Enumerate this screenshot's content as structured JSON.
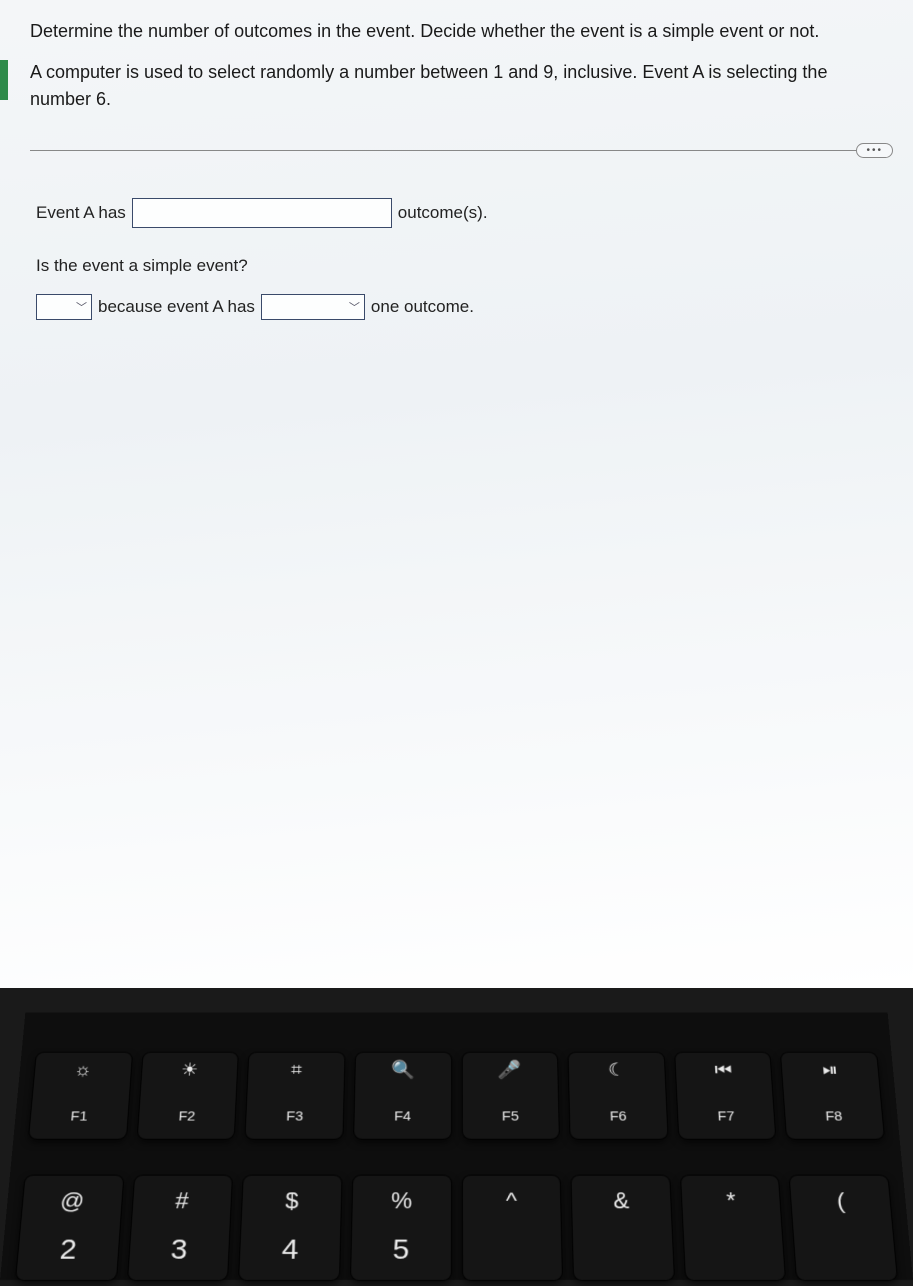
{
  "question": {
    "line1": "Determine the number of outcomes in the event. Decide whether the event is a simple event or not.",
    "line2": "A computer is used to select randomly a number between 1 and 9, inclusive. Event A is selecting the number 6."
  },
  "more_button": "•••",
  "answer": {
    "prefix": "Event A has",
    "outcomes_input": "",
    "suffix": "outcome(s).",
    "sub_question": "Is the event a simple event?",
    "yesno_value": "",
    "mid": "because event A has",
    "relation_value": "",
    "tail": "one outcome."
  },
  "keyboard": {
    "frow": [
      {
        "icon": "☼",
        "label": "F1"
      },
      {
        "icon": "☀",
        "label": "F2"
      },
      {
        "icon": "⌗",
        "label": "F3"
      },
      {
        "icon": "🔍",
        "label": "F4"
      },
      {
        "icon": "🎤",
        "label": "F5"
      },
      {
        "icon": "☾",
        "label": "F6"
      },
      {
        "icon": "⏮",
        "label": "F7"
      },
      {
        "icon": "⏯",
        "label": "F8"
      }
    ],
    "nrow": [
      {
        "sym": "@",
        "num": "2"
      },
      {
        "sym": "#",
        "num": "3"
      },
      {
        "sym": "$",
        "num": "4"
      },
      {
        "sym": "%",
        "num": "5"
      },
      {
        "sym": "^",
        "num": ""
      },
      {
        "sym": "&",
        "num": ""
      },
      {
        "sym": "*",
        "num": ""
      },
      {
        "sym": "(",
        "num": ""
      }
    ]
  }
}
